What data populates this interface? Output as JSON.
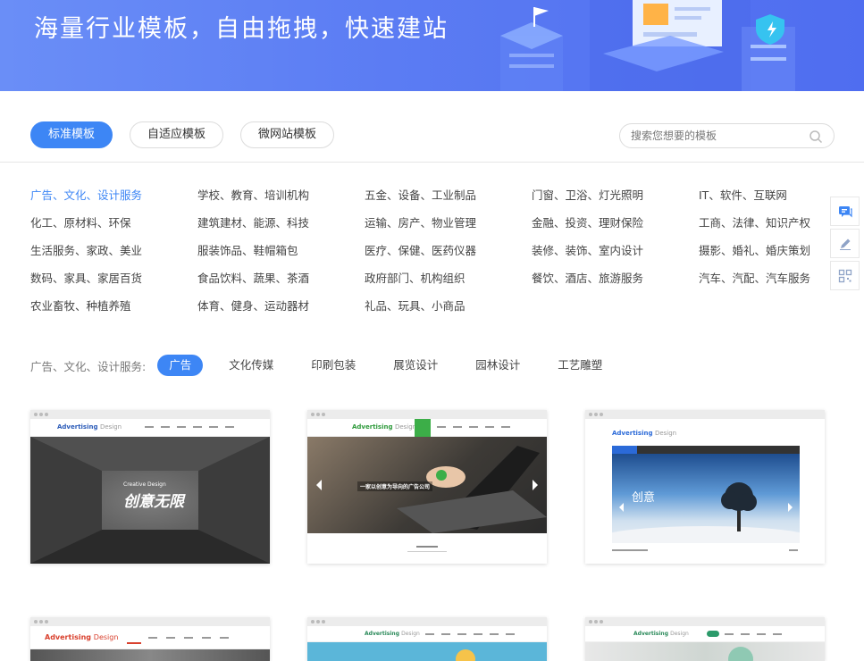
{
  "banner": {
    "title": "海量行业模板，自由拖拽，快速建站"
  },
  "tabs": [
    {
      "label": "标准模板",
      "active": true
    },
    {
      "label": "自适应模板",
      "active": false
    },
    {
      "label": "微网站模板",
      "active": false
    }
  ],
  "search": {
    "placeholder": "搜索您想要的模板",
    "icon": "search-icon"
  },
  "categories": [
    "广告、文化、设计服务",
    "学校、教育、培训机构",
    "五金、设备、工业制品",
    "门窗、卫浴、灯光照明",
    "IT、软件、互联网",
    "化工、原材料、环保",
    "建筑建材、能源、科技",
    "运输、房产、物业管理",
    "金融、投资、理财保险",
    "工商、法律、知识产权",
    "生活服务、家政、美业",
    "服装饰品、鞋帽箱包",
    "医疗、保健、医药仪器",
    "装修、装饰、室内设计",
    "摄影、婚礼、婚庆策划",
    "数码、家具、家居百货",
    "食品饮料、蔬果、茶酒",
    "政府部门、机构组织",
    "餐饮、酒店、旅游服务",
    "汽车、汽配、汽车服务",
    "农业畜牧、种植养殖",
    "体育、健身、运动器材",
    "礼品、玩具、小商品"
  ],
  "active_category_index": 0,
  "subcategory": {
    "label": "广告、文化、设计服务:",
    "items": [
      "广告",
      "文化传媒",
      "印刷包装",
      "展览设计",
      "园林设计",
      "工艺雕塑"
    ],
    "active_index": 0
  },
  "sidebar": [
    "chat-icon",
    "edit-icon",
    "qrcode-icon"
  ],
  "cards": [
    {
      "logo_a": "Advertising",
      "logo_b": "Design",
      "hero": "创意无限",
      "hero_sub": "Creative Design"
    },
    {
      "logo_a": "Advertising",
      "logo_b": "Design",
      "hero": "一家以创意为导向的广告公司"
    },
    {
      "logo_a": "Advertising",
      "logo_b": "Design",
      "hero": "创意"
    },
    {
      "logo_a": "Advertising",
      "logo_b": "Design"
    },
    {
      "logo_a": "Advertising",
      "logo_b": "Design"
    },
    {
      "logo_a": "Advertising",
      "logo_b": "Design"
    }
  ],
  "colors": {
    "accent": "#3d86f5",
    "banner": "#5b7cf3"
  }
}
